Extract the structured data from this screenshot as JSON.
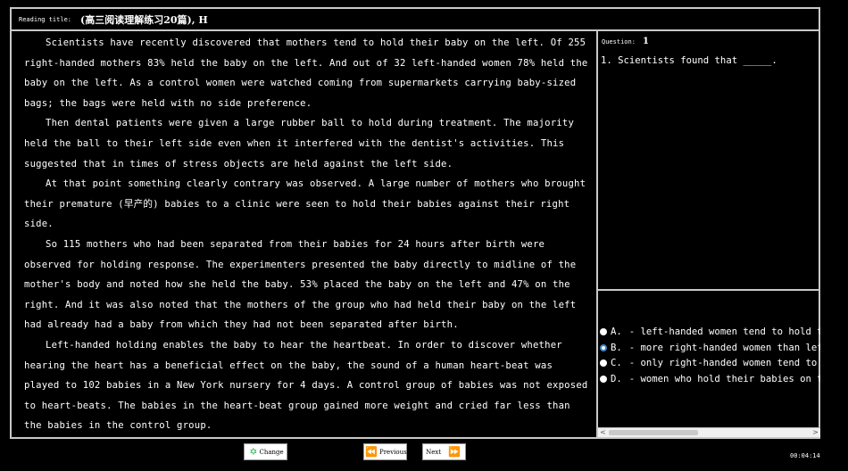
{
  "header": {
    "label": "Reading title:",
    "title": "(高三阅读理解练习20篇), H"
  },
  "passage": {
    "paragraphs": [
      "Scientists have recently discovered that mothers tend to hold their baby on the left. Of 255 right-handed mothers 83% held the baby on the left. And out of 32 left-handed women 78% held the baby on the left. As a control women were watched coming from supermarkets carrying baby-sized bags; the bags were held with no side preference.",
      "Then dental patients were given a large rubber ball to hold during treatment. The majority held the ball to their left side even when it interfered with the dentist's activities. This suggested that in times of stress objects are held against the left side.",
      "At that point something clearly contrary was observed. A large number of mothers who brought their premature (早产的) babies to a clinic were seen to hold their babies against their right side.",
      "So 115 mothers who had been separated from their babies for 24 hours after birth were observed for holding response. The experimenters presented the baby directly to midline of the mother's body and noted how she held the baby. 53% placed the baby on the left and 47% on the right. And it was also noted that the mothers of the group who had held their baby on the left had already had a baby from which they had not been separated after birth.",
      "Left-handed holding enables the baby to hear the heartbeat. In order to discover whether hearing the heart has a beneficial effect on the baby, the sound of a human heart-beat was played to 102 babies in a New York nursery for 4 days. A control group of babies was not exposed to heart-beats. The babies in the heart-beat group gained more weight and cried far less than the babies in the control group."
    ]
  },
  "question": {
    "label": "Question:",
    "number": "1",
    "text": "1. Scientists found that _____."
  },
  "options": [
    {
      "letter": "A.",
      "text": "- left-handed women tend to hold the",
      "selected": false
    },
    {
      "letter": "B.",
      "text": "- more right-handed women than left-",
      "selected": true
    },
    {
      "letter": "C.",
      "text": "- only right-handed women tend to ho",
      "selected": false
    },
    {
      "letter": "D.",
      "text": "- women who hold their babies on the",
      "selected": false
    }
  ],
  "scrollbar": {
    "left_arrow": "<",
    "right_arrow": ">"
  },
  "buttons": {
    "change": "Change",
    "previous": "Previous",
    "next": "Next"
  },
  "timer": "00:04:14",
  "colors": {
    "background": "#000000",
    "border": "#c8c8c8",
    "nav_icon": "#2fa84f",
    "selected_radio": "#3a86c8"
  }
}
